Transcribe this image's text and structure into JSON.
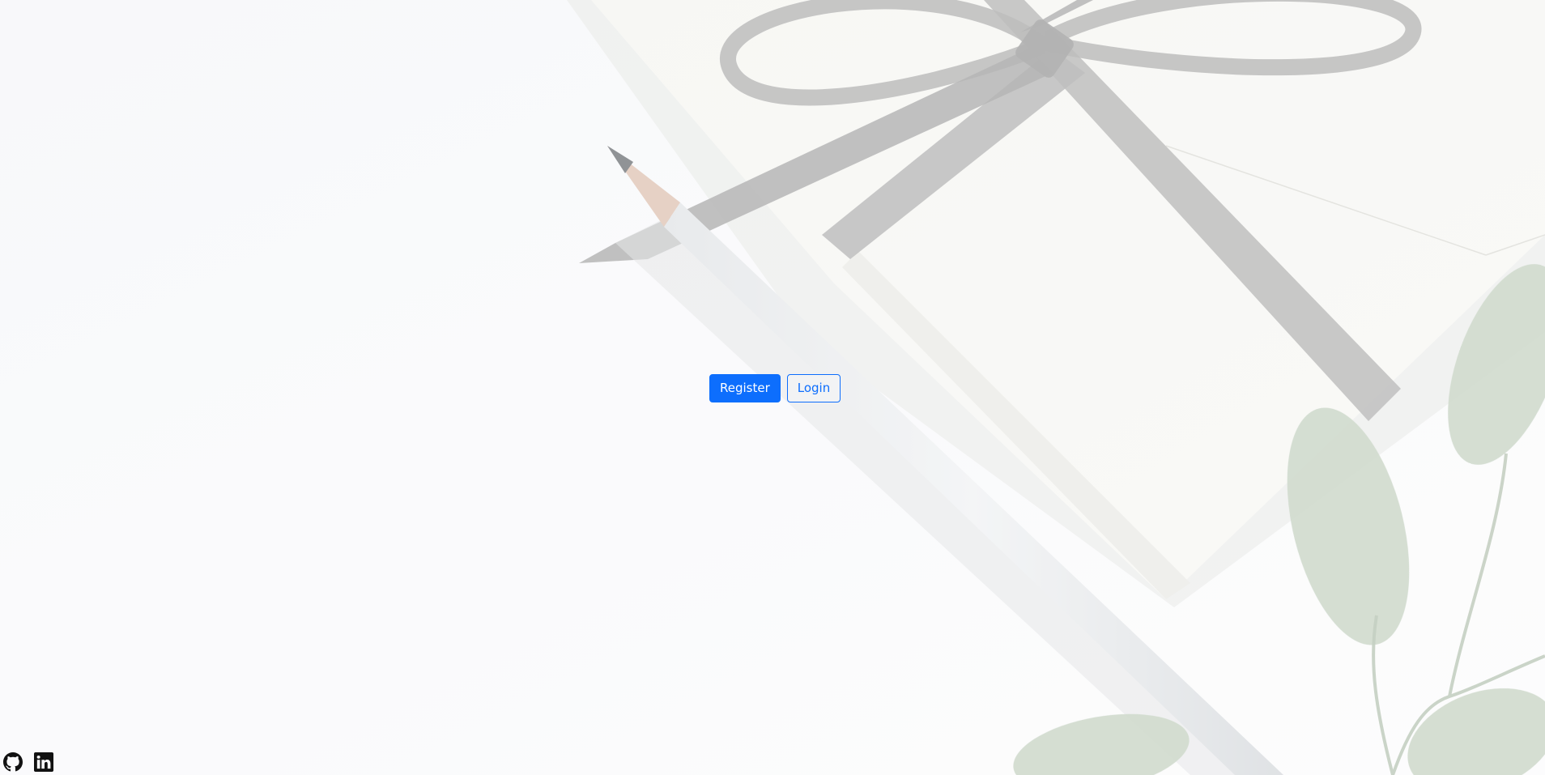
{
  "hero": {
    "background_image": "desk-photo-envelope-ribbon-pencil-eucalyptus",
    "overlay_color": "#ffffff"
  },
  "actions": {
    "register_label": "Register",
    "login_label": "Login",
    "primary_color": "#0d6efd"
  },
  "footer": {
    "social_icons": [
      "github-icon",
      "linkedin-icon"
    ]
  }
}
